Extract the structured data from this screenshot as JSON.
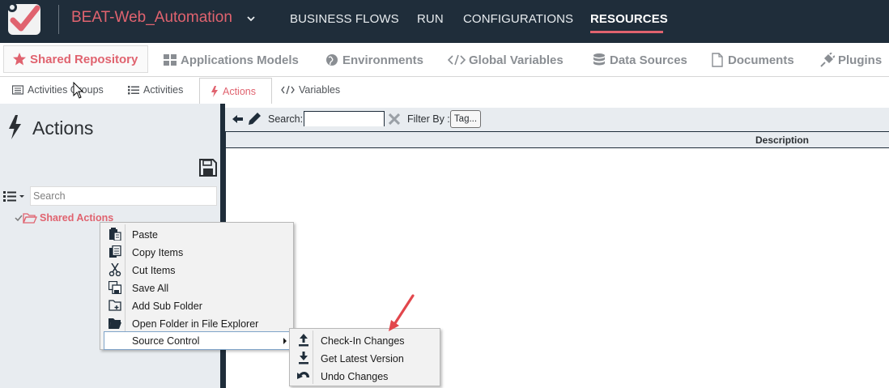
{
  "app": {
    "title": "BEAT-Web_Automation",
    "brand_color": "#e0636f",
    "topbar_color": "#1f2d3a"
  },
  "main_nav": [
    {
      "label": "BUSINESS FLOWS"
    },
    {
      "label": "RUN"
    },
    {
      "label": "CONFIGURATIONS"
    },
    {
      "label": "RESOURCES",
      "active": true
    }
  ],
  "resource_tabs": [
    {
      "label": "Shared Repository",
      "icon": "star-icon",
      "active": true
    },
    {
      "label": "Applications Models",
      "icon": "grid-icon"
    },
    {
      "label": "Environments",
      "icon": "globe-icon"
    },
    {
      "label": "Global  Variables",
      "icon": "code-icon"
    },
    {
      "label": "Data Sources",
      "icon": "database-icon"
    },
    {
      "label": "Documents",
      "icon": "file-icon"
    },
    {
      "label": "Plugins",
      "icon": "plug-icon"
    }
  ],
  "repo_tabs": [
    {
      "label": "Activities Groups",
      "icon": "list-box-icon"
    },
    {
      "label": "Activities",
      "icon": "list-icon"
    },
    {
      "label": "Actions",
      "icon": "bolt-icon",
      "active": true
    },
    {
      "label": "Variables",
      "icon": "code-icon"
    }
  ],
  "left_panel": {
    "title": "Actions",
    "search_placeholder": "Search",
    "tree_root": "Shared Actions"
  },
  "right_panel": {
    "search_label": "Search:",
    "search_value": "",
    "filter_label": "Filter By :",
    "tag_button": "Tag...",
    "columns": [
      "Description"
    ]
  },
  "context_menu": {
    "items": [
      {
        "label": "Paste",
        "icon": "paste-icon"
      },
      {
        "label": "Copy Items",
        "icon": "copy-icon"
      },
      {
        "label": "Cut Items",
        "icon": "scissors-icon"
      },
      {
        "label": "Save All",
        "icon": "save-all-icon"
      },
      {
        "label": "Add Sub Folder",
        "icon": "add-folder-icon"
      },
      {
        "label": "Open Folder in File Explorer",
        "icon": "folder-open-icon"
      },
      {
        "label": "Source Control",
        "icon": "",
        "submenu": true,
        "highlighted": true
      }
    ],
    "submenu": [
      {
        "label": "Check-In Changes",
        "icon": "upload-icon"
      },
      {
        "label": "Get Latest Version",
        "icon": "download-icon"
      },
      {
        "label": "Undo Changes",
        "icon": "undo-icon"
      }
    ]
  }
}
